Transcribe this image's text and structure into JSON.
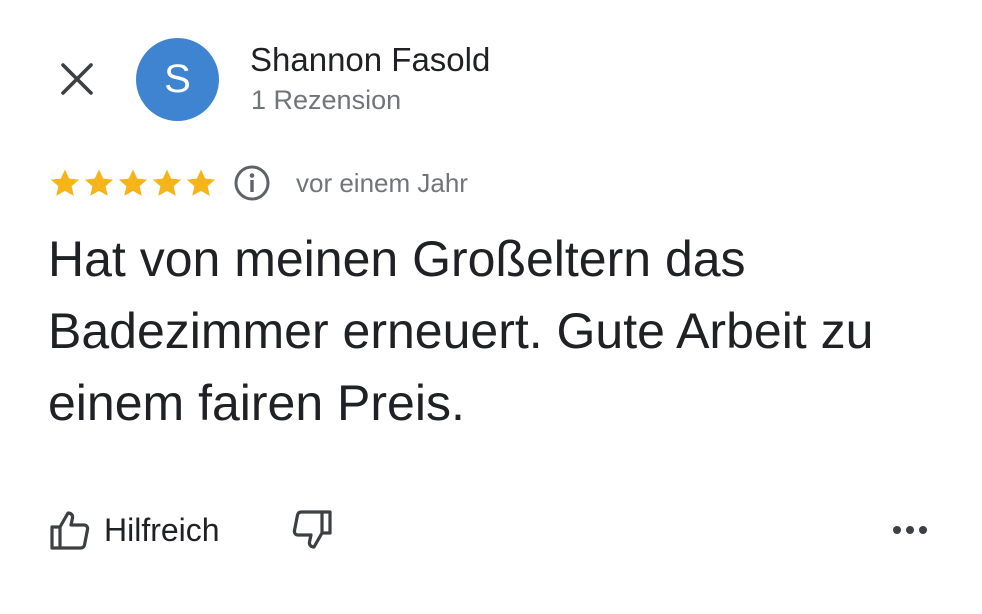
{
  "header": {
    "close_icon": "close-icon",
    "avatar_letter": "S",
    "avatar_color": "#3f84d1",
    "author_name": "Shannon Fasold",
    "review_count": "1 Rezension"
  },
  "rating": {
    "stars": 5,
    "max_stars": 5,
    "star_color": "#f4b41a",
    "info_icon": "info-icon",
    "time": "vor einem Jahr"
  },
  "review": {
    "text": "Hat von meinen Großeltern das Badezimmer erneuert. Gute Arbeit zu einem fairen Preis."
  },
  "actions": {
    "helpful_icon": "thumbs-up-icon",
    "helpful_label": "Hilfreich",
    "not_helpful_icon": "thumbs-down-icon",
    "more_icon": "more-horizontal-icon"
  }
}
